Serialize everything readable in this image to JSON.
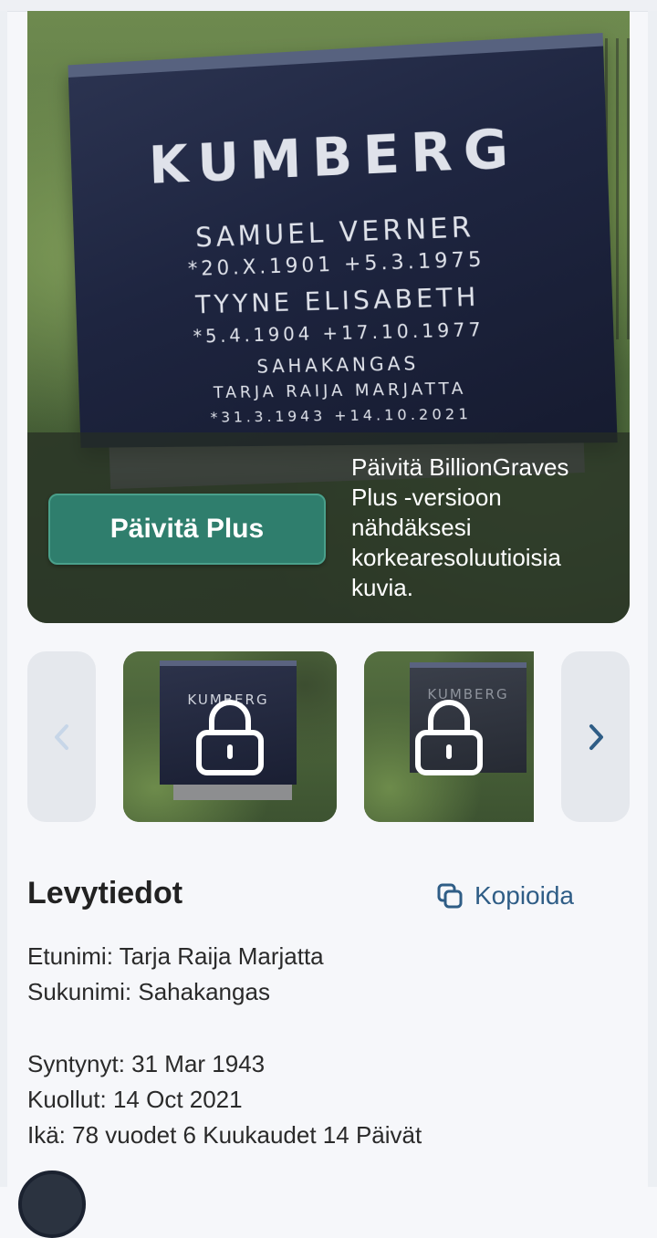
{
  "hero": {
    "stone_lines": [
      "KUMBERG",
      "SAMUEL VERNER",
      "*20.X.1901 +5.3.1975",
      "TYYNE ELISABETH",
      "*5.4.1904 +17.10.1977",
      "SAHAKANGAS",
      "TARJA RAIJA MARJATTA",
      "*31.3.1943 +14.10.2021"
    ],
    "upgrade_button": "Päivitä Plus",
    "upgrade_text": "Päivitä BillionGraves Plus -versioon nähdäksesi korkearesoluutioisia kuvia."
  },
  "thumbnails": {
    "thumb1_text": "KUMBERG",
    "thumb2_text": "KUMBERG",
    "prev_icon": "chevron-left-icon",
    "next_icon": "chevron-right-icon",
    "lock_icon": "lock-icon"
  },
  "record": {
    "title": "Levytiedot",
    "copy_label": "Kopioida",
    "first_name": "Etunimi: Tarja Raija Marjatta",
    "last_name": "Sukunimi: Sahakangas",
    "born": "Syntynyt: 31 Mar 1943",
    "died": "Kuollut: 14 Oct 2021",
    "age": "Ikä: 78 vuodet 6 Kuukaudet 14 Päivät"
  },
  "colors": {
    "accent": "#2f7e6d",
    "link": "#2f5d86"
  }
}
